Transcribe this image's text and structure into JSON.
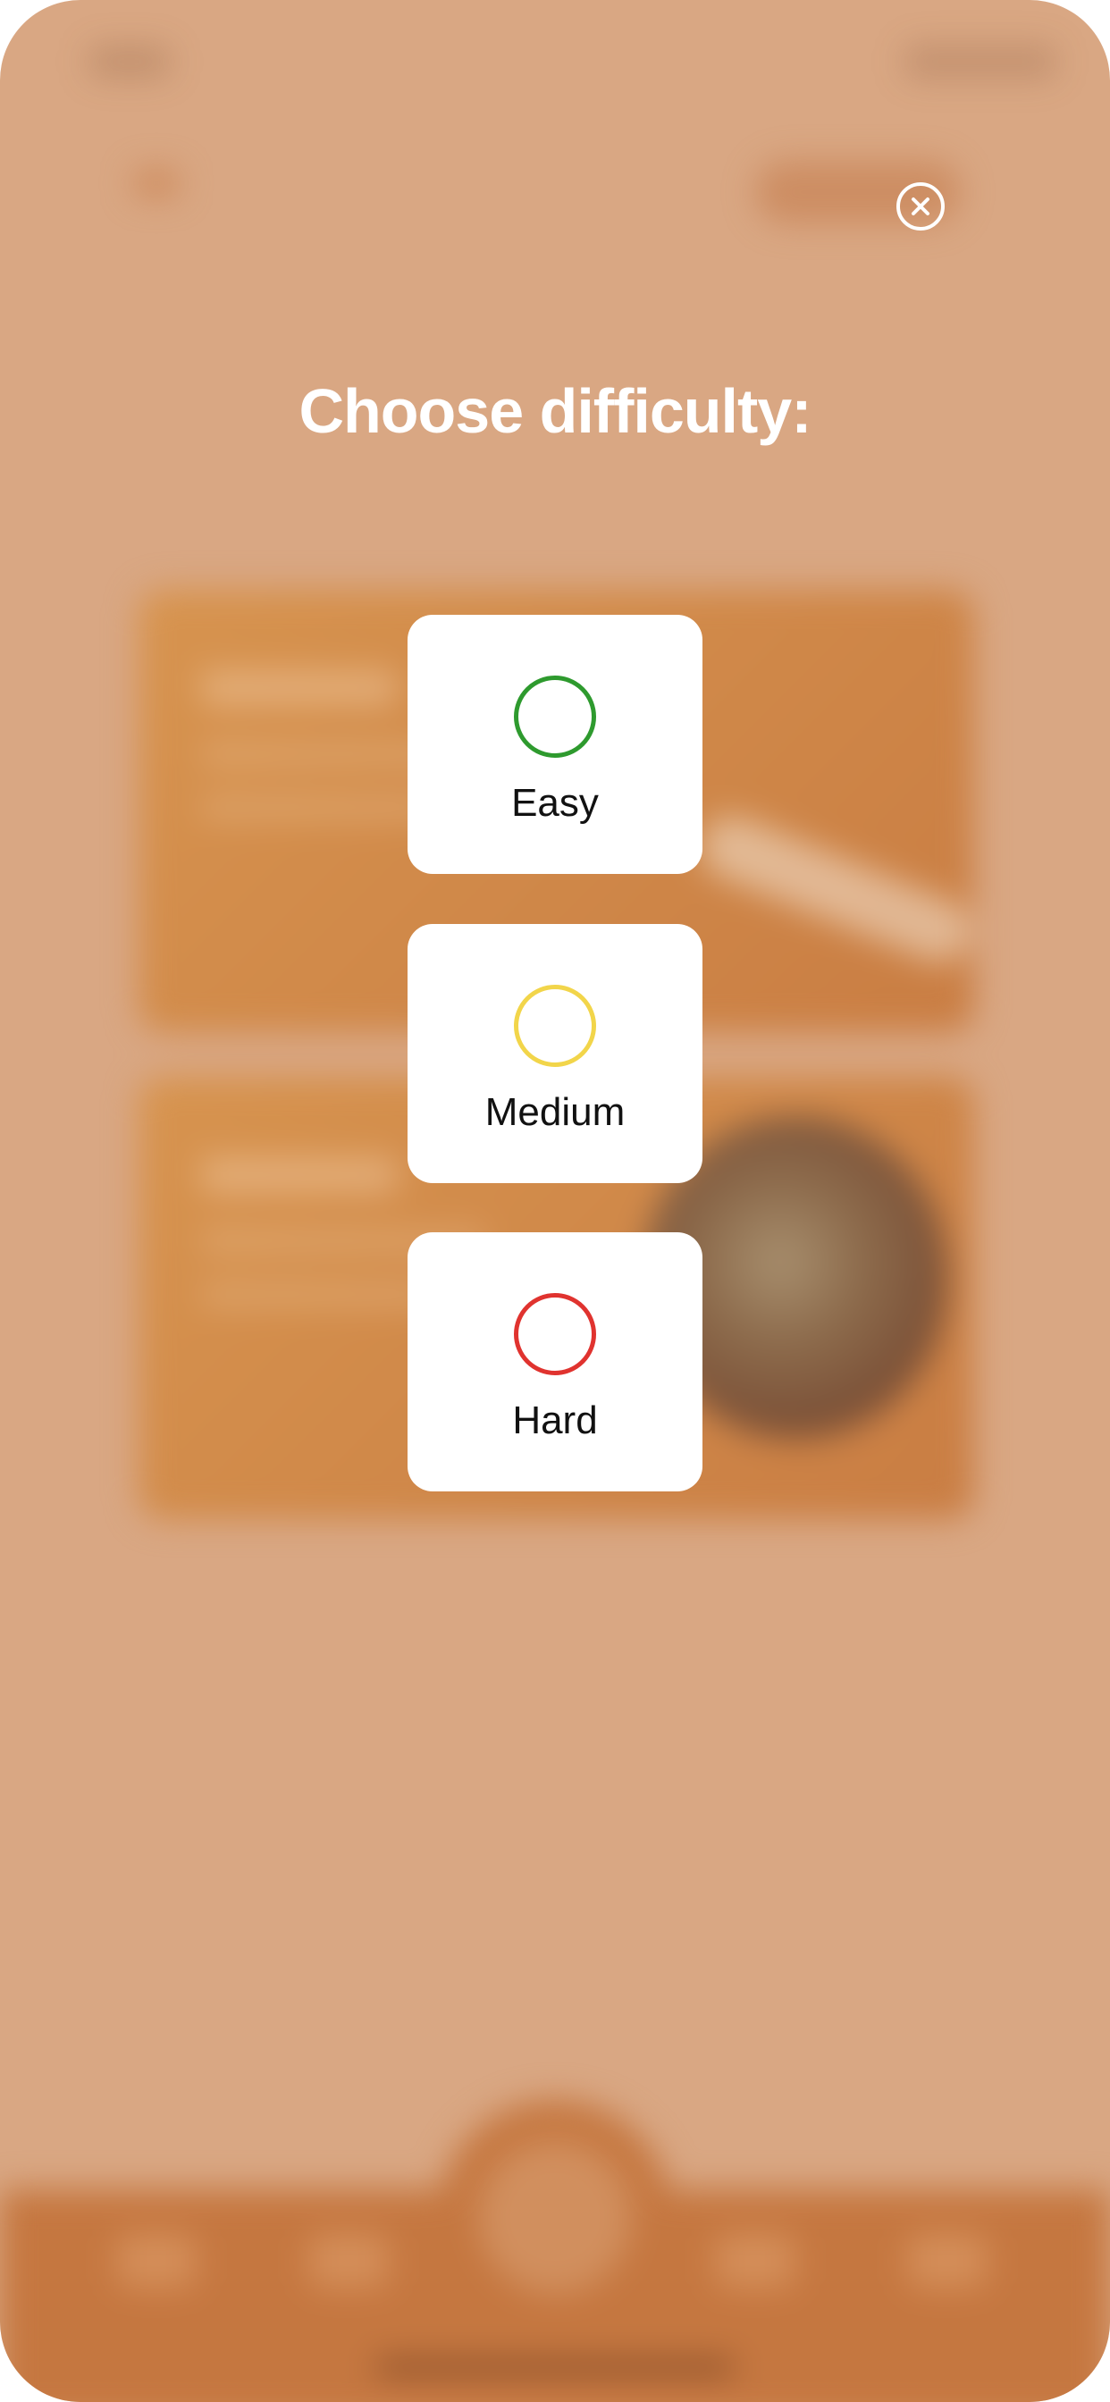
{
  "modal": {
    "title": "Choose difficulty:",
    "close_icon": "close-icon",
    "options": [
      {
        "label": "Easy",
        "color": "#2e9a2e"
      },
      {
        "label": "Medium",
        "color": "#f2d54a"
      },
      {
        "label": "Hard",
        "color": "#e0332f"
      }
    ]
  },
  "colors": {
    "overlay_background": "#d9a783",
    "accent": "#c57740",
    "card_background": "#ffffff"
  }
}
